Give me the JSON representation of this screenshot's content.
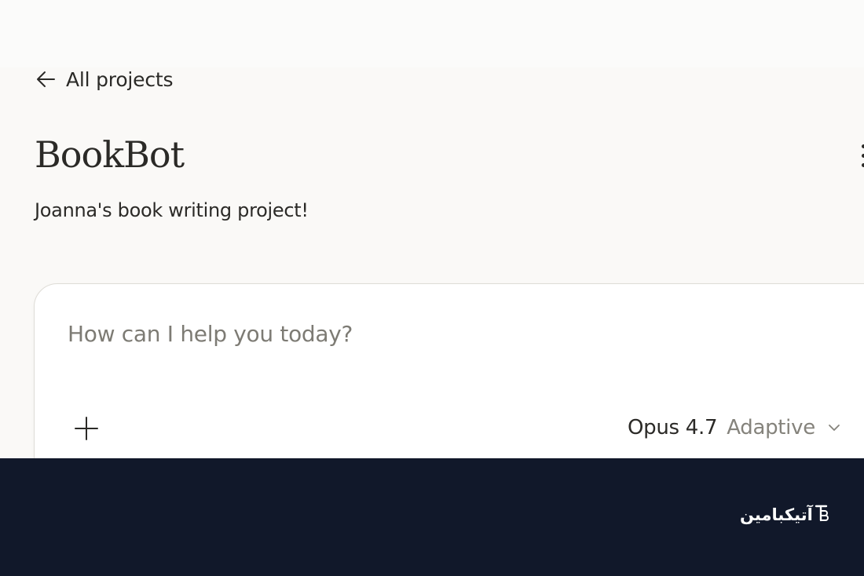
{
  "nav": {
    "back_label": "All projects",
    "back_icon": "arrow-left-icon"
  },
  "project": {
    "title": "BookBot",
    "description": "Joanna's book writing project!",
    "menu_icon": "more-vertical-icon"
  },
  "composer": {
    "placeholder": "How can I help you today?",
    "value": "",
    "add_icon": "plus-icon",
    "model": {
      "name": "Opus 4.7",
      "mode": "Adaptive",
      "chevron_icon": "chevron-down-icon"
    }
  },
  "footer": {
    "brand_text": "آتیکبامین",
    "brand_logo_icon": "brand-logo-icon"
  },
  "colors": {
    "page_background": "#faf9f7",
    "text": "#2b2a27",
    "muted_text": "#85837c",
    "footer_background": "#11182a"
  }
}
